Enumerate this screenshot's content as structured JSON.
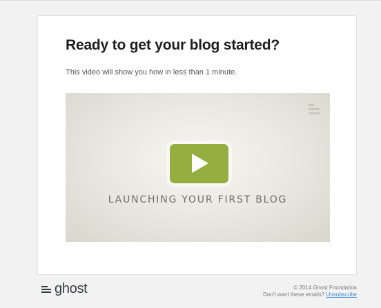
{
  "email": {
    "headline": "Ready to get your blog started?",
    "subtext": "This video will show you how in less than 1 minute.",
    "video": {
      "title": "LAUNCHING YOUR FIRST BLOG",
      "play_icon": "play-icon",
      "menu_icon": "ghost-menu-icon",
      "accent_color": "#94ae3f"
    }
  },
  "footer": {
    "logo_text": "ghost",
    "logo_icon": "ghost-logo-icon",
    "copyright": "© 2014 Ghost Foundation",
    "unsubscribe_prompt": "Don't want these emails?",
    "unsubscribe_label": "Unsubscribe",
    "link_color": "#3b8ad9"
  }
}
